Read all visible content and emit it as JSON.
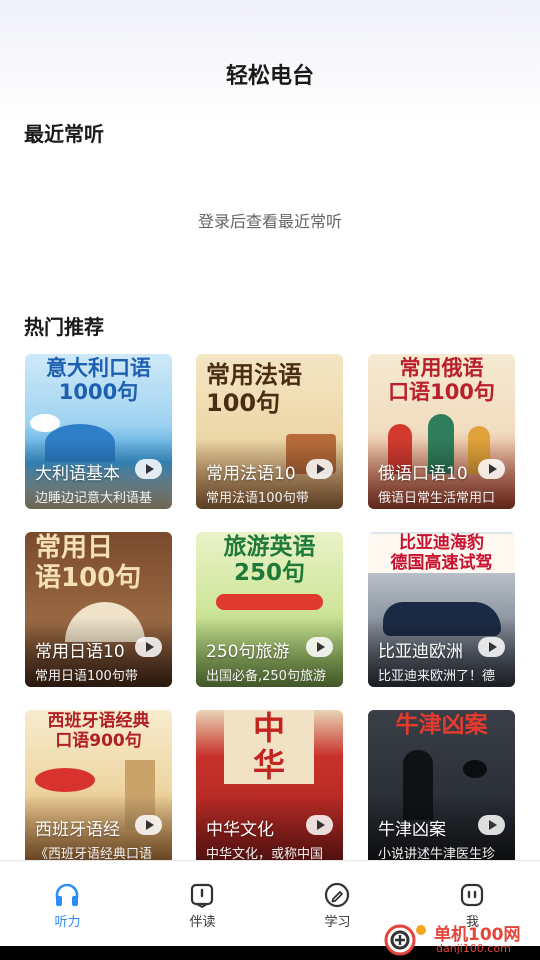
{
  "header": {
    "title": "轻松电台"
  },
  "recent": {
    "title": "最近常听",
    "empty_hint": "登录后查看最近常听"
  },
  "hot": {
    "title": "热门推荐",
    "items": [
      {
        "cover": "意大利口语\n1000句",
        "name": "大利语基本",
        "sub": "边睡边记意大利语基"
      },
      {
        "cover": "常用法语\n100句",
        "name": "常用法语10",
        "sub": "常用法语100句带"
      },
      {
        "cover": "常用俄语\n口语100句",
        "name": "俄语口语10",
        "sub": "俄语日常生活常用口"
      },
      {
        "cover": "常用日\n语100句",
        "name": "常用日语10",
        "sub": "常用日语100句带"
      },
      {
        "cover": "旅游英语\n250句",
        "name": "250句旅游",
        "sub": "出国必备,250句旅游"
      },
      {
        "cover": "比亚迪海豹\n德国高速试驾",
        "name": "比亚迪欧洲",
        "sub": "比亚迪来欧洲了！德"
      },
      {
        "cover": "西班牙语经典\n口语900句",
        "name": "西班牙语经",
        "sub": "《西班牙语经典口语"
      },
      {
        "cover": "中\n华",
        "name": "中华文化",
        "sub": "中华文化，或称中国"
      },
      {
        "cover": "牛津凶案",
        "name": "牛津凶案",
        "sub": "小说讲述牛津医生珍"
      }
    ]
  },
  "tabs": [
    {
      "label": "听力",
      "icon": "headphones-icon"
    },
    {
      "label": "伴读",
      "icon": "book-icon"
    },
    {
      "label": "学习",
      "icon": "pencil-icon"
    },
    {
      "label": "我",
      "icon": "profile-icon"
    }
  ],
  "watermark": {
    "text": "单机100网",
    "url": "danji100.com"
  },
  "colors": {
    "accent": "#2f8cf3",
    "watermark": "#e5443a"
  }
}
